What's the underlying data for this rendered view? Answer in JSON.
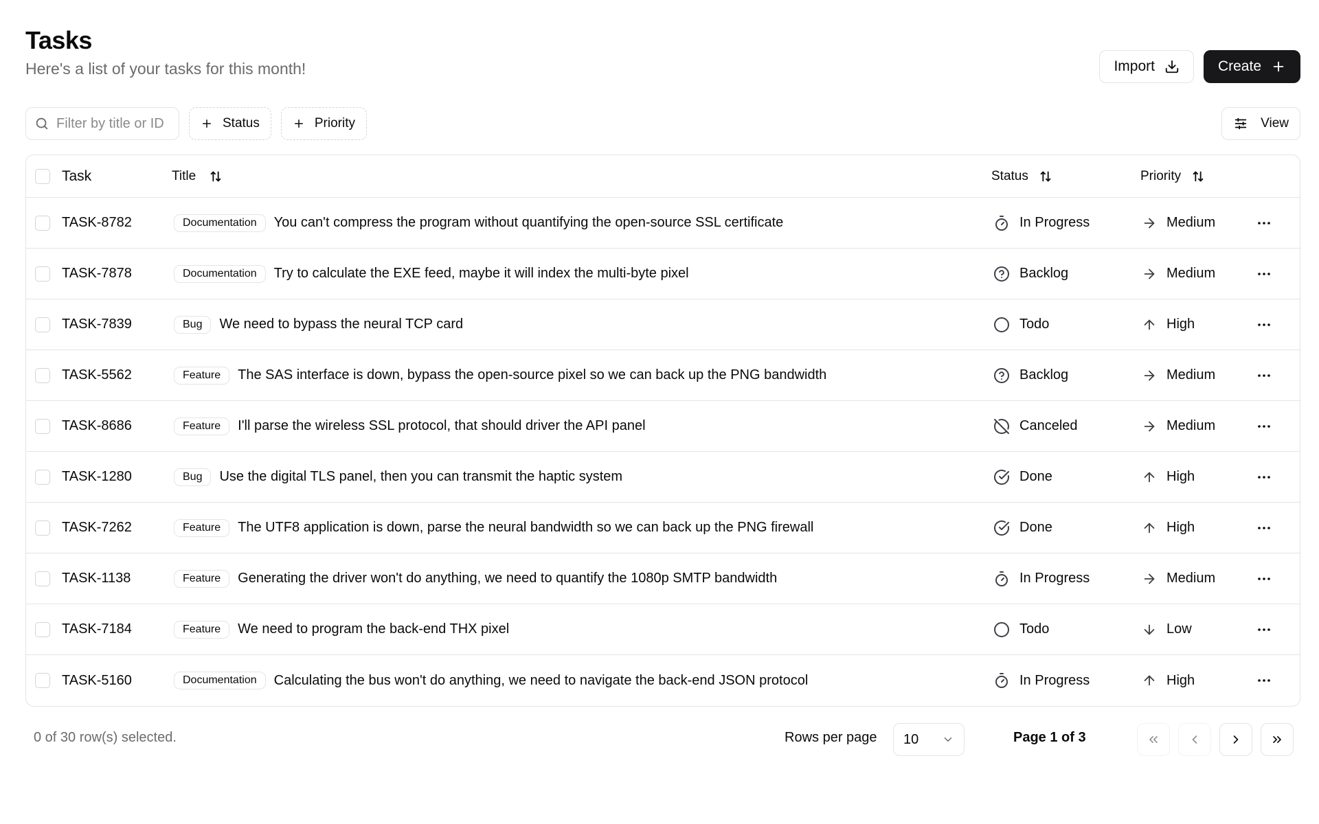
{
  "header": {
    "title": "Tasks",
    "subtitle": "Here's a list of your tasks for this month!",
    "import_label": "Import",
    "create_label": "Create"
  },
  "toolbar": {
    "search_placeholder": "Filter by title or ID",
    "status_chip": "Status",
    "priority_chip": "Priority",
    "view_label": "View"
  },
  "columns": {
    "task": "Task",
    "title": "Title",
    "status": "Status",
    "priority": "Priority"
  },
  "rows": [
    {
      "id": "TASK-8782",
      "label": "Documentation",
      "title": "You can't compress the program without quantifying the open-source SSL certificate",
      "status": "In Progress",
      "status_icon": "timer-icon",
      "priority": "Medium",
      "priority_icon": "arrow-right-icon"
    },
    {
      "id": "TASK-7878",
      "label": "Documentation",
      "title": "Try to calculate the EXE feed, maybe it will index the multi-byte pixel",
      "status": "Backlog",
      "status_icon": "help-circle-icon",
      "priority": "Medium",
      "priority_icon": "arrow-right-icon"
    },
    {
      "id": "TASK-7839",
      "label": "Bug",
      "title": "We need to bypass the neural TCP card",
      "status": "Todo",
      "status_icon": "circle-icon",
      "priority": "High",
      "priority_icon": "arrow-up-icon"
    },
    {
      "id": "TASK-5562",
      "label": "Feature",
      "title": "The SAS interface is down, bypass the open-source pixel so we can back up the PNG bandwidth",
      "status": "Backlog",
      "status_icon": "help-circle-icon",
      "priority": "Medium",
      "priority_icon": "arrow-right-icon"
    },
    {
      "id": "TASK-8686",
      "label": "Feature",
      "title": "I'll parse the wireless SSL protocol, that should driver the API panel",
      "status": "Canceled",
      "status_icon": "circle-off-icon",
      "priority": "Medium",
      "priority_icon": "arrow-right-icon"
    },
    {
      "id": "TASK-1280",
      "label": "Bug",
      "title": "Use the digital TLS panel, then you can transmit the haptic system",
      "status": "Done",
      "status_icon": "check-circle-icon",
      "priority": "High",
      "priority_icon": "arrow-up-icon"
    },
    {
      "id": "TASK-7262",
      "label": "Feature",
      "title": "The UTF8 application is down, parse the neural bandwidth so we can back up the PNG firewall",
      "status": "Done",
      "status_icon": "check-circle-icon",
      "priority": "High",
      "priority_icon": "arrow-up-icon"
    },
    {
      "id": "TASK-1138",
      "label": "Feature",
      "title": "Generating the driver won't do anything, we need to quantify the 1080p SMTP bandwidth",
      "status": "In Progress",
      "status_icon": "timer-icon",
      "priority": "Medium",
      "priority_icon": "arrow-right-icon"
    },
    {
      "id": "TASK-7184",
      "label": "Feature",
      "title": "We need to program the back-end THX pixel",
      "status": "Todo",
      "status_icon": "circle-icon",
      "priority": "Low",
      "priority_icon": "arrow-down-icon"
    },
    {
      "id": "TASK-5160",
      "label": "Documentation",
      "title": "Calculating the bus won't do anything, we need to navigate the back-end JSON protocol",
      "status": "In Progress",
      "status_icon": "timer-icon",
      "priority": "High",
      "priority_icon": "arrow-up-icon"
    }
  ],
  "footer": {
    "selected_text": "0 of 30 row(s) selected.",
    "rows_per_page_label": "Rows per page",
    "rows_per_page_value": "10",
    "page_label": "Page 1 of 3"
  },
  "colors": {
    "primary": "#18181b",
    "border": "#e4e4e7",
    "muted_text": "#6b6b6b"
  }
}
